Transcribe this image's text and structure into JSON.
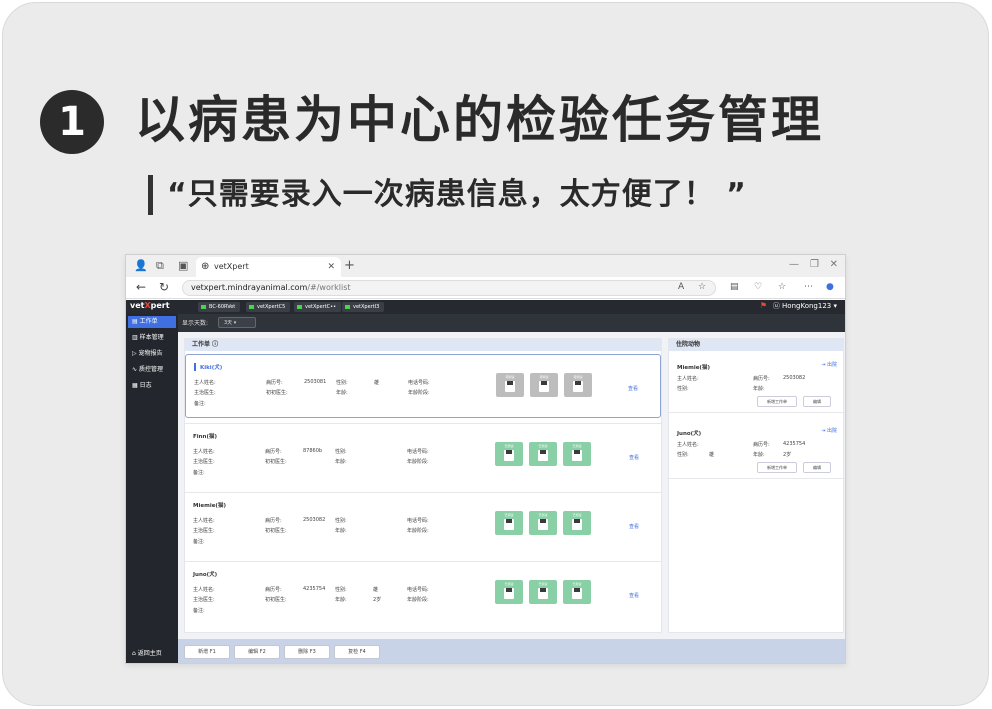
{
  "promo": {
    "step_number": "1",
    "headline": "以病患为中心的检验任务管理",
    "quote": "“只需要录入一次病患信息，太方便了！ ”"
  },
  "browser": {
    "tab_title": "vetXpert",
    "url_host": "vetxpert.mindrayanimal.com",
    "url_path": "/#/worklist"
  },
  "app": {
    "logo_pre": "vet",
    "logo_x": "X",
    "logo_post": "pert",
    "device_tabs": [
      "BC-60RVet",
      "vetXpertC5",
      "vetXpertC••",
      "vetXpertI3"
    ],
    "user": "HongKong123",
    "filter_label": "显示天数:",
    "filter_value": "3天",
    "sidebar": [
      {
        "label": "工作单",
        "active": true
      },
      {
        "label": "样本管理",
        "active": false
      },
      {
        "label": "宠物报告",
        "active": false
      },
      {
        "label": "质控管理",
        "active": false
      },
      {
        "label": "日志",
        "active": false
      }
    ],
    "home_label": "返回主页",
    "worklist_title": "工作单",
    "labels": {
      "owner": "主人姓名:",
      "vet": "主治医生:",
      "note": "备注:",
      "record": "病历号:",
      "doctor": "初初医生:",
      "gender": "性别:",
      "age": "年龄:",
      "phone": "电话号码:",
      "age_stage": "年龄阶段:",
      "view": "查看"
    },
    "patients": [
      {
        "name": "Kiki(犬)",
        "record": "2503081",
        "gender": "雄",
        "age": "",
        "samples": [
          "待测试",
          "待测试",
          "待测试"
        ],
        "status": "gray"
      },
      {
        "name": "Finn(猫)",
        "record": "87860b",
        "gender": "",
        "age": "",
        "samples": [
          "已测试",
          "已测试",
          "已测试"
        ],
        "status": "green"
      },
      {
        "name": "Miemie(猫)",
        "record": "2503082",
        "gender": "",
        "age": "",
        "samples": [
          "已测试",
          "已测试",
          "已测试"
        ],
        "status": "green"
      },
      {
        "name": "Juno(犬)",
        "record": "4235754",
        "gender": "雄",
        "age": "2岁",
        "samples": [
          "已测试",
          "已测试",
          "已测试"
        ],
        "status": "green"
      }
    ],
    "inpatient": {
      "title": "住院动物",
      "discharge": "出院",
      "record_label": "病历号:",
      "owner_label": "主人姓名:",
      "gender_label": "性别:",
      "age_label": "年龄:",
      "new_worklist": "新增工作单",
      "edit": "编辑",
      "items": [
        {
          "name": "Miemie(猫)",
          "record": "2503082",
          "gender": "",
          "age": ""
        },
        {
          "name": "Juno(犬)",
          "record": "4235754",
          "gender": "雄",
          "age": "2岁"
        }
      ]
    },
    "footer_buttons": [
      "新增 F1",
      "编辑 F2",
      "删除 F3",
      "复检 F4"
    ]
  }
}
